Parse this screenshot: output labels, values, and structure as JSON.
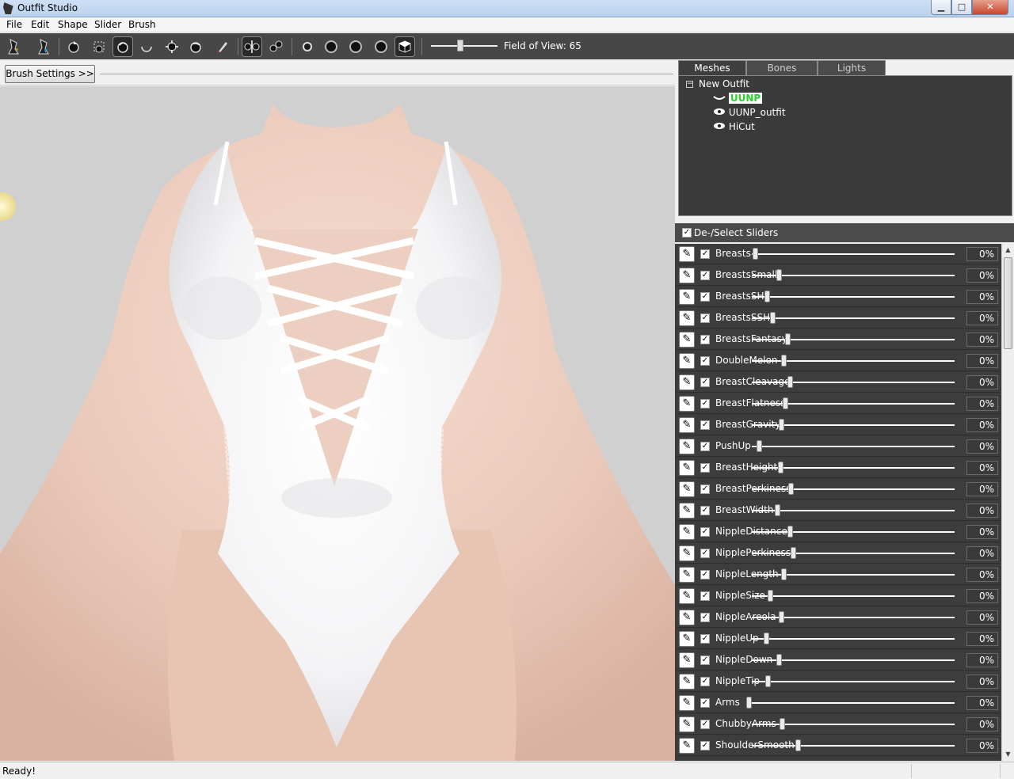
{
  "window": {
    "title": "Outfit Studio",
    "minimize": "▁",
    "maximize": "□",
    "close": "✕"
  },
  "menu": [
    "File",
    "Edit",
    "Shape",
    "Slider",
    "Brush"
  ],
  "toolbar": {
    "fov_label": "Field of View: 65",
    "fov_value": 65
  },
  "brush_settings_label": "Brush Settings >>",
  "tabs": [
    "Meshes",
    "Bones",
    "Lights"
  ],
  "mesh_tree": {
    "root": "New Outfit",
    "expander": "−",
    "items": [
      "UUNP",
      "UUNP_outfit",
      "HiCut"
    ]
  },
  "deselect_label": "De-/Select Sliders",
  "sliders": [
    {
      "name": "Breasts",
      "value": "0%"
    },
    {
      "name": "BreastsSmall",
      "value": "0%"
    },
    {
      "name": "BreastsSH",
      "value": "0%"
    },
    {
      "name": "BreastsSSH",
      "value": "0%"
    },
    {
      "name": "BreastsFantasy",
      "value": "0%"
    },
    {
      "name": "DoubleMelon",
      "value": "0%"
    },
    {
      "name": "BreastCleavage",
      "value": "0%"
    },
    {
      "name": "BreastFlatness",
      "value": "0%"
    },
    {
      "name": "BreastGravity",
      "value": "0%"
    },
    {
      "name": "PushUp",
      "value": "0%"
    },
    {
      "name": "BreastHeight",
      "value": "0%"
    },
    {
      "name": "BreastPerkiness",
      "value": "0%"
    },
    {
      "name": "BreastWidth",
      "value": "0%"
    },
    {
      "name": "NippleDistance",
      "value": "0%"
    },
    {
      "name": "NipplePerkiness",
      "value": "0%"
    },
    {
      "name": "NippleLength",
      "value": "0%"
    },
    {
      "name": "NippleSize",
      "value": "0%"
    },
    {
      "name": "NippleAreola",
      "value": "0%"
    },
    {
      "name": "NippleUp",
      "value": "0%"
    },
    {
      "name": "NippleDown",
      "value": "0%"
    },
    {
      "name": "NippleTip",
      "value": "0%"
    },
    {
      "name": "Arms",
      "value": "0%"
    },
    {
      "name": "ChubbyArms",
      "value": "0%"
    },
    {
      "name": "ShoulderSmooth",
      "value": "0%"
    }
  ],
  "checkmark": "✓",
  "pencil": "✎",
  "status": "Ready!",
  "icons": [
    "outfit-open-icon",
    "reference-icon",
    "select-icon",
    "mask-icon",
    "inflate-brush-icon",
    "deflate-brush-icon",
    "move-brush-icon",
    "smooth-brush-icon",
    "weight-brush-icon",
    "mirror-icon",
    "connected-icon",
    "x-axis-icon",
    "y-axis-icon",
    "z-axis-icon",
    "perspective-icon",
    "cube-icon"
  ]
}
